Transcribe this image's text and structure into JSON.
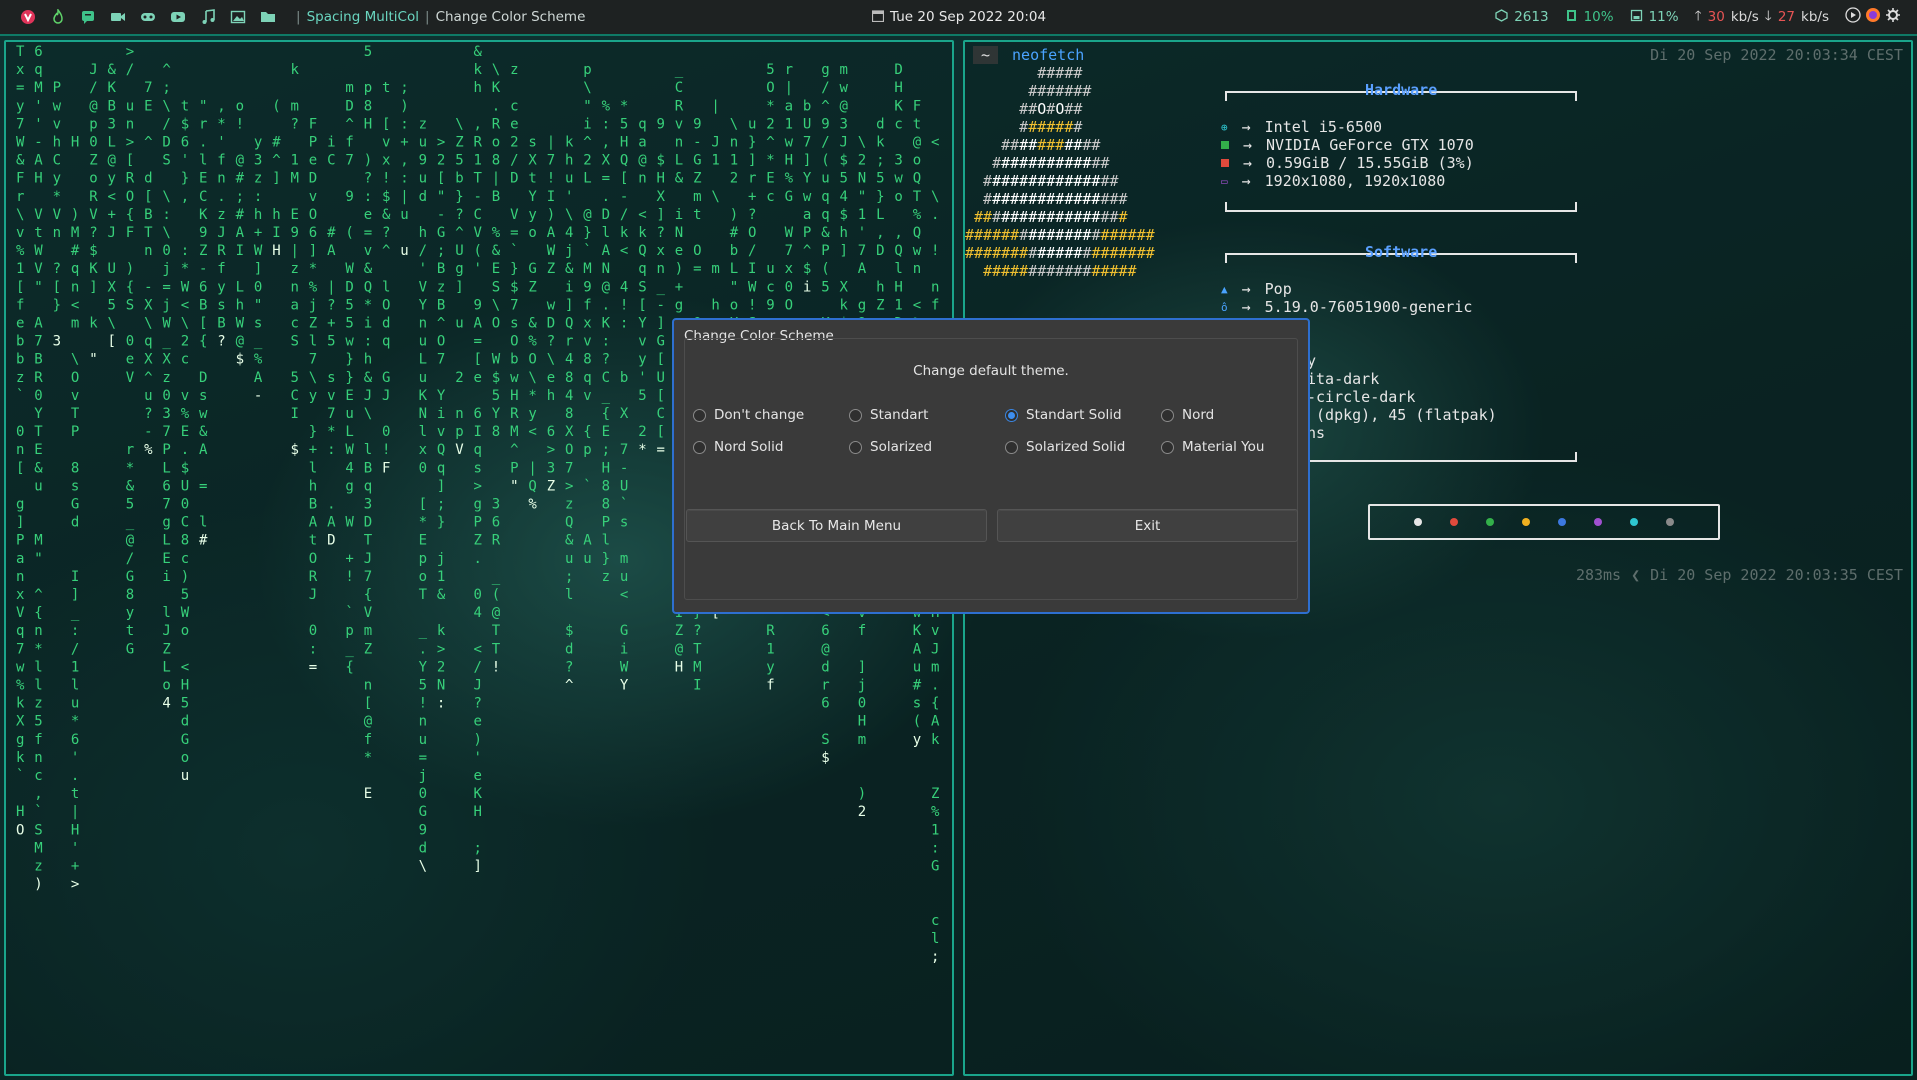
{
  "topbar": {
    "app_icons": [
      "vivaldi-icon",
      "flame-icon",
      "chat-icon",
      "video-camera-icon",
      "gamepad-icon",
      "youtube-icon",
      "music-note-icon",
      "image-icon",
      "folder-icon"
    ],
    "window_title": "Spacing MultiCol",
    "window_subtitle": "Change Color Scheme",
    "datetime": "Tue 20 Sep 2022 20:04",
    "updates": "2613",
    "cpu": "10%",
    "disk": "11%",
    "net_up": "30",
    "net_up_unit": "kb/s",
    "net_down": "27",
    "net_down_unit": "kb/s",
    "tray_icons": [
      "media-play-icon",
      "firefox-icon",
      "settings-gear-icon"
    ]
  },
  "terminal": {
    "prompt_dir": "~",
    "command": "neofetch",
    "timestamp_top": "Di 20 Sep 2022 20:03:34 CEST",
    "duration": "283ms",
    "timestamp_bottom": "Di 20 Sep 2022 20:03:35 CEST",
    "hardware": {
      "title": "Hardware",
      "rows": [
        "Intel i5-6500",
        "NVIDIA GeForce GTX 1070",
        "0.59GiB / 15.55GiB (3%)",
        "1920x1080, 1920x1080"
      ]
    },
    "software": {
      "title": "Software",
      "rows": [
        "Pop",
        "5.19.0-76051900-generic",
        "y",
        "ita-dark",
        "-circle-dark",
        " (dpkg), 45 (flatpak)",
        "ns"
      ]
    },
    "arrow": "→",
    "palette_colors": [
      "#e6e6e6",
      "#e04a3c",
      "#33b04a",
      "#f0b020",
      "#3c78e0",
      "#a050d0",
      "#2ec6d0",
      "#8a8a8a"
    ]
  },
  "dialog": {
    "title": "Change Color Scheme",
    "subtitle": "Change default theme.",
    "options": [
      "Don't change",
      "Standart",
      "Standart Solid",
      "Nord",
      "Nord Solid",
      "Solarized",
      "Solarized Solid",
      "Material You"
    ],
    "selected": "Standart Solid",
    "back_button": "Back To Main Menu",
    "exit_button": "Exit"
  },
  "colors": {
    "matrix_green": "#37d07a",
    "accent_border": "#1aa58b",
    "dialog_border": "#2e6fd0",
    "radio_selected": "#3d8ef0"
  }
}
